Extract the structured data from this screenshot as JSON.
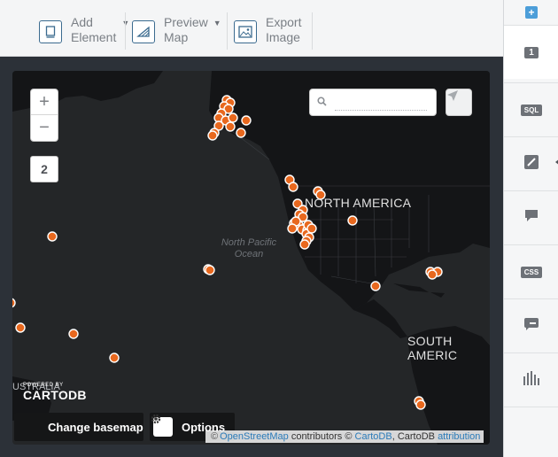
{
  "toolbar": {
    "add_element": {
      "line1": "Add",
      "line2": "Element"
    },
    "preview_map": {
      "line1": "Preview",
      "line2": "Map"
    },
    "export_image": {
      "line1": "Export",
      "line2": "Image"
    }
  },
  "sidebar": {
    "add_symbol": "+",
    "items": [
      {
        "icon": "layer-number-icon",
        "label": "1"
      },
      {
        "icon": "sql-icon",
        "label": "SQL"
      },
      {
        "icon": "style-wizard-icon",
        "label": ""
      },
      {
        "icon": "infowindow-icon",
        "label": ""
      },
      {
        "icon": "css-icon",
        "label": "CSS"
      },
      {
        "icon": "legend-icon",
        "label": ""
      },
      {
        "icon": "histogram-icon",
        "label": ""
      }
    ]
  },
  "map": {
    "zoom_in": "+",
    "zoom_out": "−",
    "zoom_level": "2",
    "search_value": "",
    "labels": {
      "north_america": "NORTH AMERICA",
      "south_america": "SOUTH AMERIC",
      "ocean_line1": "North Pacific",
      "ocean_line2": "Ocean",
      "australia_fragment": "USTRALIA"
    },
    "powered_by": "POWERED BY",
    "brand": "CARTODB",
    "change_basemap": "Change basemap",
    "options": "Options",
    "attribution": {
      "prefix": "©",
      "osm": "OpenStreetMap",
      "mid": " contributors © ",
      "cartodb": "CartoDB",
      "sep": ", CartoDB ",
      "attr": "attribution"
    },
    "colors": {
      "marker": "#e8681e",
      "marker_stroke": "#ffffff",
      "land": "#141517",
      "water": "#242628"
    }
  }
}
